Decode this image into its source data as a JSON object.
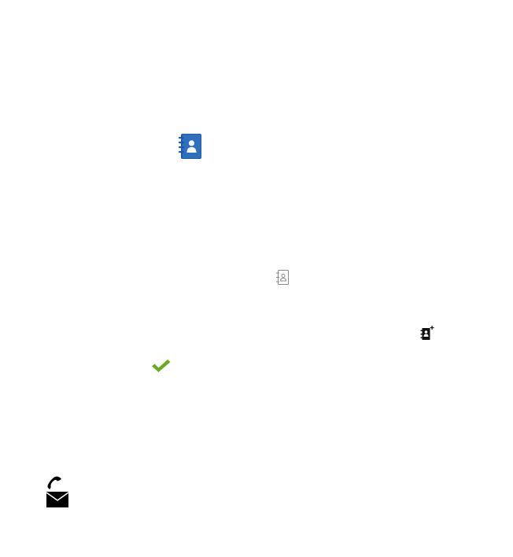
{
  "icons": [
    {
      "name": "address-book-icon",
      "style": "blue-filled",
      "color": "#1e5aa8",
      "accent": "#3d86d6"
    },
    {
      "name": "address-book-outline-icon",
      "style": "outline",
      "color": "#8a8a8a"
    },
    {
      "name": "add-contact-icon",
      "style": "black-filled",
      "color": "#111111"
    },
    {
      "name": "checkmark-icon",
      "style": "filled",
      "color": "#6aaa1e"
    },
    {
      "name": "phone-mail-icon",
      "style": "black-filled",
      "color": "#000000"
    }
  ]
}
